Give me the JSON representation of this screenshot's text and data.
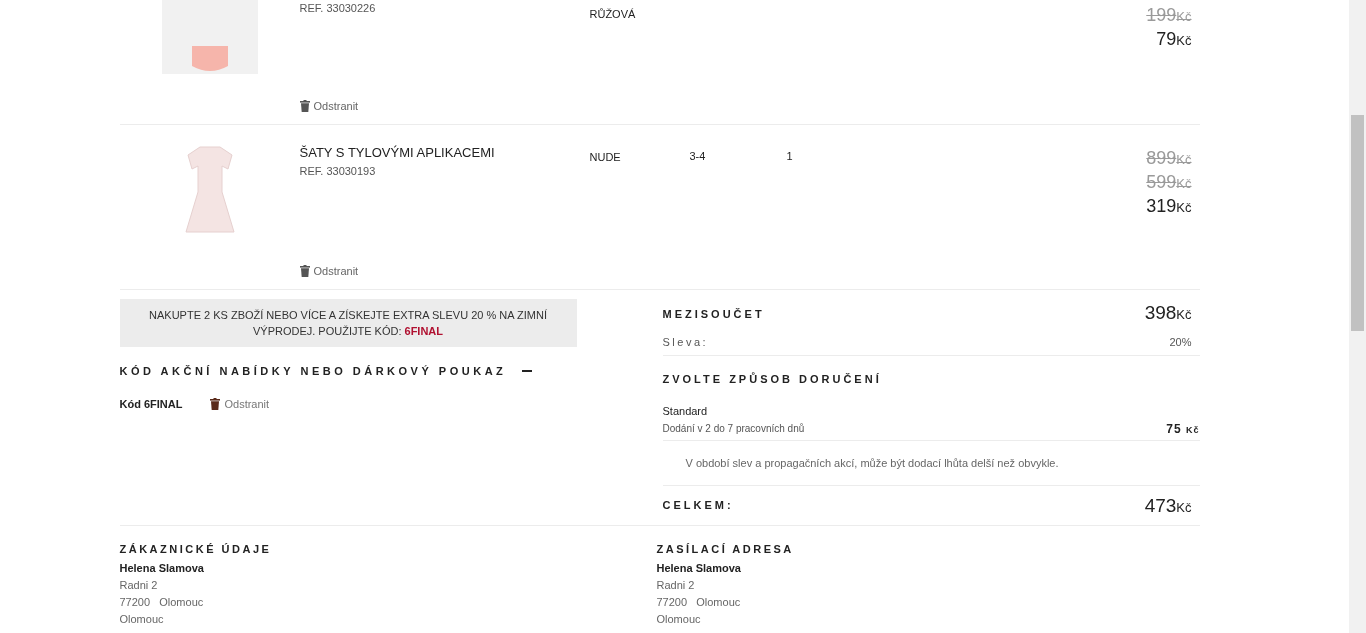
{
  "items": [
    {
      "ref": "REF. 33030226",
      "colour_name": "RŮŽOVÁ",
      "kind": "shirt",
      "prices": [
        {
          "amount": "199",
          "currency": "Kč",
          "struck": true
        },
        {
          "amount": "79",
          "currency": "Kč",
          "struck": false
        }
      ],
      "remove": "Odstranit"
    },
    {
      "name": "ŠATY S TYLOVÝMI APLIKACEMI",
      "ref": "REF. 33030193",
      "colour_name": "NUDE",
      "size": "3-4",
      "qty": "1",
      "kind": "dress",
      "prices": [
        {
          "amount": "899",
          "currency": "Kč",
          "struck": true
        },
        {
          "amount": "599",
          "currency": "Kč",
          "struck": true
        },
        {
          "amount": "319",
          "currency": "Kč",
          "struck": false
        }
      ],
      "remove": "Odstranit"
    }
  ],
  "promo": {
    "text": "NAKUPTE 2 KS ZBOŽÍ NEBO VÍCE A ZÍSKEJTE EXTRA SLEVU 20 % NA ZIMNÍ VÝPRODEJ. POUŽIJTE KÓD: ",
    "code": "6FINAL"
  },
  "voucher": {
    "title": "KÓD AKČNÍ NABÍDKY NEBO DÁRKOVÝ POUKAZ",
    "expanded": true,
    "code_label": "Kód 6FINAL",
    "remove": "Odstranit"
  },
  "summary": {
    "subtotal_label": "MEZISOUČET",
    "subtotal": {
      "amount": "398",
      "currency": "Kč"
    },
    "discount_label": "Sleva:",
    "discount": "20%",
    "delivery_title": "ZVOLTE ZPŮSOB DORUČENÍ",
    "delivery_name": "Standard",
    "delivery_desc": "Dodání v 2 do 7 pracovních dnů",
    "delivery_price": {
      "amount": "75",
      "currency": "Kč"
    },
    "delivery_note": "V období slev a propagačních akcí, může být dodací lhůta delší než obvykle.",
    "total_label": "CELKEM:",
    "total": {
      "amount": "473",
      "currency": "Kč"
    }
  },
  "addresses": [
    {
      "title": "ZÁKAZNICKÉ ÚDAJE",
      "name": "Helena Slamova",
      "lines": [
        "Radni 2",
        "77200   Olomouc",
        "Olomouc"
      ]
    },
    {
      "title": "ZASÍLACÍ ADRESA",
      "name": "Helena Slamova",
      "lines": [
        "Radni 2",
        "77200   Olomouc",
        "Olomouc"
      ]
    }
  ]
}
